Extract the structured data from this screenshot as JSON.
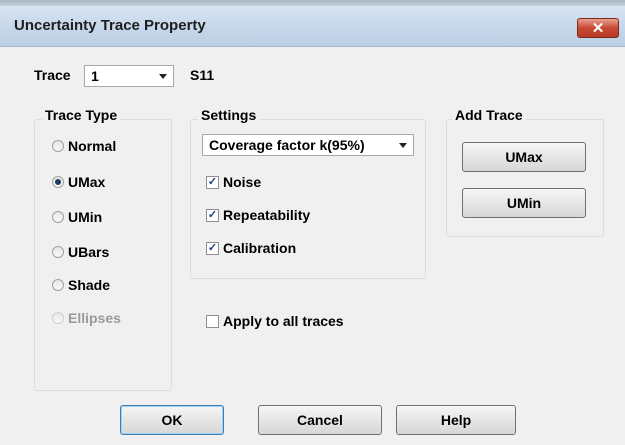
{
  "window": {
    "title": "Uncertainty Trace Property",
    "close_glyph": "✕"
  },
  "trace": {
    "label": "Trace",
    "selected": "1",
    "name": "S11"
  },
  "trace_type": {
    "title": "Trace Type",
    "options": [
      {
        "label": "Normal",
        "checked": false,
        "enabled": true
      },
      {
        "label": "UMax",
        "checked": true,
        "enabled": true
      },
      {
        "label": "UMin",
        "checked": false,
        "enabled": true
      },
      {
        "label": "UBars",
        "checked": false,
        "enabled": true
      },
      {
        "label": "Shade",
        "checked": false,
        "enabled": true
      },
      {
        "label": "Ellipses",
        "checked": false,
        "enabled": false
      }
    ]
  },
  "settings": {
    "title": "Settings",
    "coverage_selected": "Coverage factor k(95%)",
    "checks": [
      {
        "label": "Noise",
        "checked": true
      },
      {
        "label": "Repeatability",
        "checked": true
      },
      {
        "label": "Calibration",
        "checked": true
      }
    ]
  },
  "add_trace": {
    "title": "Add Trace",
    "umax_label": "UMax",
    "umin_label": "UMin"
  },
  "apply_all": {
    "label": "Apply to all traces",
    "checked": false
  },
  "footer": {
    "ok_label": "OK",
    "cancel_label": "Cancel",
    "help_label": "Help"
  },
  "icons": {
    "close": "close-icon",
    "dropdown": "chevron-down-icon",
    "check": "checkmark-icon"
  },
  "colors": {
    "title_bar": "#c6d7ea",
    "close_button": "#c94a34",
    "background": "#f0f0f0"
  }
}
